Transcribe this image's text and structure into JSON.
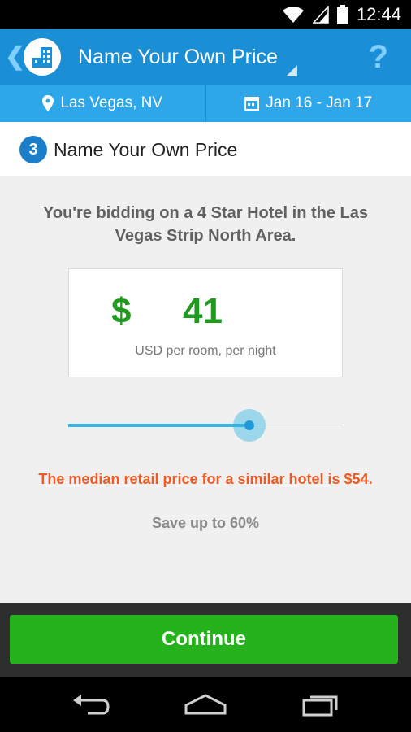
{
  "status_bar": {
    "time": "12:44"
  },
  "action_bar": {
    "title": "Name Your Own Price",
    "help": "?"
  },
  "info_bar": {
    "location": "Las Vegas, NV",
    "dates": "Jan 16 - Jan 17"
  },
  "step": {
    "number": "3",
    "title": "Name Your Own Price"
  },
  "bid": {
    "description": "You're bidding on a 4 Star Hotel in the Las Vegas Strip North Area.",
    "currency_symbol": "$",
    "amount": "41",
    "caption": "USD per room, per night"
  },
  "slider": {
    "fraction": 0.66
  },
  "median": {
    "text": "The median retail price for a similar hotel is $54.",
    "save": "Save up to 60%"
  },
  "footer": {
    "continue_label": "Continue"
  },
  "colors": {
    "primary": "#1a8fd6",
    "secondary": "#2ea6ea",
    "price": "#1f9a1f",
    "warning": "#ef5a24",
    "cta": "#26b21c"
  }
}
